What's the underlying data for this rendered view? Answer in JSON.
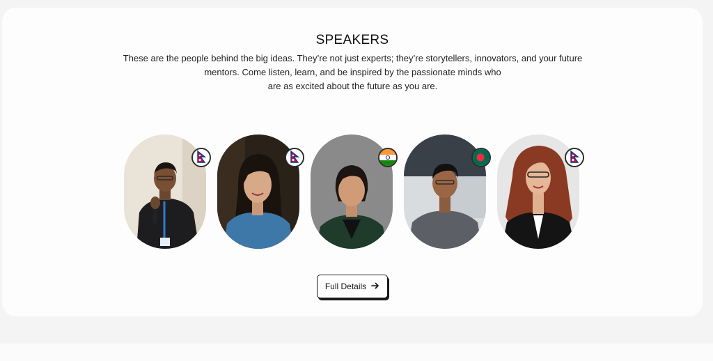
{
  "section": {
    "title": "SPEAKERS",
    "description_lines": [
      "These are the people behind the big ideas. They’re not just experts; they’re storytellers, innovators, and your future",
      "mentors. Come listen, learn, and be inspired by the passionate minds who",
      "are as excited about the future as you are."
    ]
  },
  "speakers": [
    {
      "photo": "speaker-photo-man-with-microphone",
      "flag_icon": "nepal-flag-icon"
    },
    {
      "photo": "speaker-photo-woman-blue-jacket",
      "flag_icon": "nepal-flag-icon"
    },
    {
      "photo": "speaker-photo-woman-green-blazer",
      "flag_icon": "india-flag-icon"
    },
    {
      "photo": "speaker-photo-man-grey-polo",
      "flag_icon": "bangladesh-flag-icon"
    },
    {
      "photo": "speaker-photo-woman-red-hair-glasses",
      "flag_icon": "nepal-flag-icon"
    }
  ],
  "cta": {
    "label": "Full Details",
    "icon": "arrow-right-icon"
  },
  "colors": {
    "page_background": "#f4f4f4",
    "card_background": "#fdfdfd",
    "text": "#1a1a1a",
    "nepal_red": "#d21034",
    "nepal_blue": "#003893",
    "india_saffron": "#ff9933",
    "india_green": "#138808",
    "bangladesh_green": "#006a4e",
    "bangladesh_red": "#f42a41"
  }
}
